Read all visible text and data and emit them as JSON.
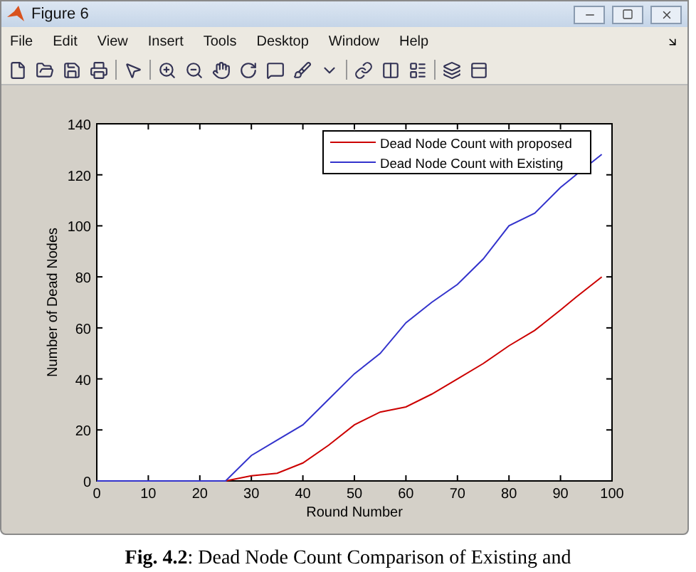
{
  "window": {
    "title": "Figure 6"
  },
  "menu": [
    "File",
    "Edit",
    "View",
    "Insert",
    "Tools",
    "Desktop",
    "Window",
    "Help"
  ],
  "figure": {
    "chart_data": {
      "type": "line",
      "xlabel": "Round Number",
      "ylabel": "Number of Dead Nodes",
      "x": [
        0,
        10,
        20,
        25,
        30,
        35,
        40,
        45,
        50,
        55,
        60,
        65,
        70,
        75,
        80,
        85,
        90,
        93,
        98
      ],
      "series": [
        {
          "name": "Dead Node Count with proposed",
          "color": "#cc0000",
          "values": [
            null,
            null,
            null,
            0,
            2,
            3,
            7,
            14,
            22,
            27,
            29,
            34,
            40,
            46,
            53,
            59,
            67,
            72,
            80
          ]
        },
        {
          "name": "Dead Node Count with Existing",
          "color": "#3333cc",
          "values": [
            0,
            0,
            0,
            0,
            10,
            16,
            22,
            32,
            42,
            50,
            62,
            70,
            77,
            87,
            100,
            105,
            115,
            120,
            128
          ]
        }
      ],
      "legend": "top right",
      "xlim": [
        0,
        100
      ],
      "ylim": [
        0,
        140
      ],
      "xticks": [
        0,
        10,
        20,
        30,
        40,
        50,
        60,
        70,
        80,
        90,
        100
      ],
      "yticks": [
        0,
        20,
        40,
        60,
        80,
        100,
        120,
        140
      ]
    }
  },
  "caption": "**Fig. 4.2**: Dead Node Count Comparison of Existing and"
}
